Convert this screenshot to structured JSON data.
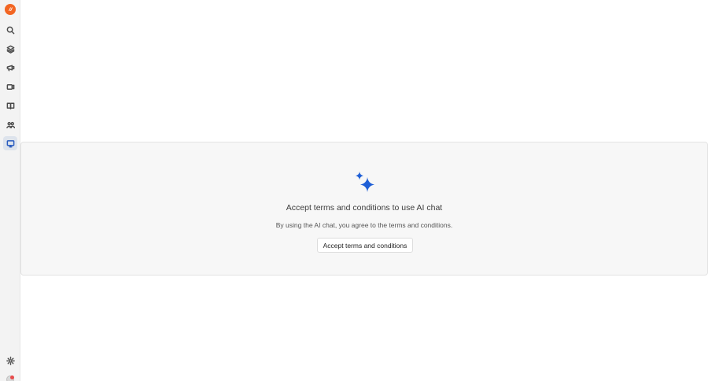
{
  "sidebar": {
    "logo": "app-logo",
    "items": [
      {
        "icon": "search-icon",
        "active": false
      },
      {
        "icon": "layers-icon",
        "active": false
      },
      {
        "icon": "megaphone-icon",
        "active": false
      },
      {
        "icon": "video-icon",
        "active": false
      },
      {
        "icon": "book-icon",
        "active": false
      },
      {
        "icon": "users-icon",
        "active": false
      },
      {
        "icon": "chat-icon",
        "active": true
      }
    ],
    "bottom": [
      {
        "icon": "gear-icon"
      }
    ]
  },
  "main": {
    "icon": "sparkle-icon",
    "title": "Accept terms and conditions to use AI chat",
    "subtitle": "By using the AI chat, you agree to the terms and conditions.",
    "button_label": "Accept terms and conditions"
  },
  "colors": {
    "accent": "#2a5cbf",
    "sparkle": "#1f5fd6",
    "logo": "#f26522"
  }
}
